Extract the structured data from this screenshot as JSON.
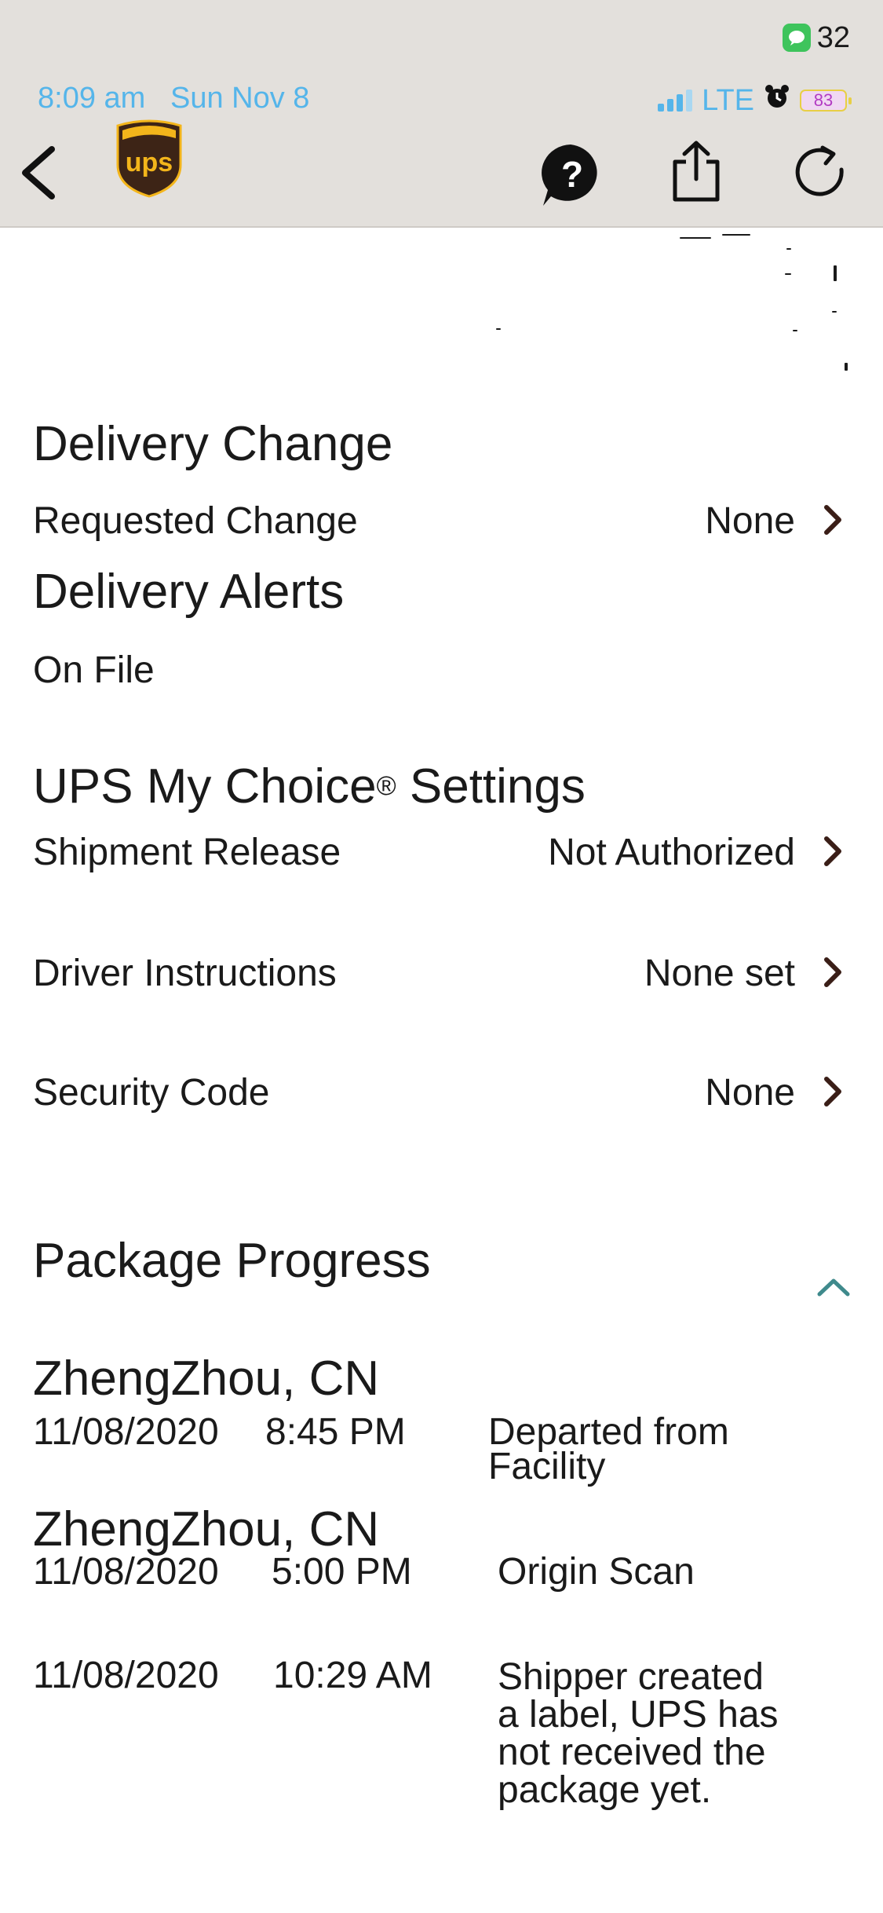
{
  "status_bar": {
    "notification_count": "32",
    "time_date": "8:09 am   Sun Nov 8",
    "network": "LTE",
    "battery": "83"
  },
  "header": {
    "logo_text": "ups"
  },
  "delivery_change": {
    "title": "Delivery Change",
    "requested_change_label": "Requested Change",
    "requested_change_value": "None"
  },
  "delivery_alerts": {
    "title": "Delivery Alerts",
    "status": "On File"
  },
  "my_choice": {
    "title": "UPS My Choice",
    "title_mark": "®",
    "title_suffix": " Settings",
    "rows": [
      {
        "label": "Shipment Release",
        "value": "Not Authorized"
      },
      {
        "label": "Driver Instructions",
        "value": "None set"
      },
      {
        "label": "Security Code",
        "value": "None"
      }
    ]
  },
  "package_progress": {
    "title": "Package Progress",
    "events": [
      {
        "location": "ZhengZhou, CN",
        "date": "11/08/2020",
        "time": "8:45 PM",
        "status": "Departed from Facility"
      },
      {
        "location": "ZhengZhou, CN",
        "date": "11/08/2020",
        "time": "5:00 PM",
        "status": "Origin Scan"
      },
      {
        "location": "",
        "date": "11/08/2020",
        "time": "10:29 AM",
        "status": "Shipper created a label, UPS has not received the package yet."
      }
    ]
  },
  "colors": {
    "status_blue": "#55b5ea",
    "chevron_dark": "#3a1e17",
    "chevron_teal": "#3f8a8c",
    "ups_brown": "#3d2416",
    "ups_gold": "#f3b51b"
  },
  "icons": [
    "messages-icon",
    "signal-icon",
    "alarm-icon",
    "battery-icon",
    "back-chevron-icon",
    "ups-logo",
    "help-icon",
    "share-icon",
    "refresh-icon",
    "chevron-right-icon",
    "chevron-up-icon"
  ]
}
